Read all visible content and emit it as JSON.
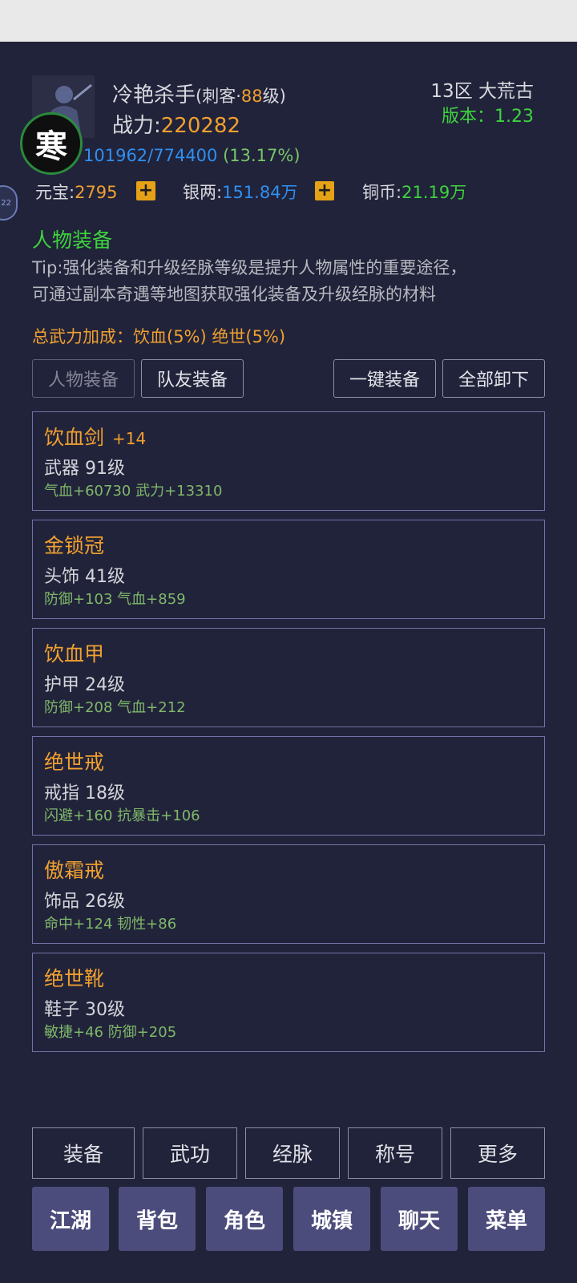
{
  "player": {
    "name": "冷艳杀手",
    "class_prefix": "(刺客·",
    "level": "88",
    "level_suffix": "级)",
    "power_label": "战力:",
    "power_value": "220282",
    "avatar_badge": "寒",
    "side_tab": "22"
  },
  "server": {
    "zone": "13区 大荒古",
    "version_label": "版本：1.23"
  },
  "experience": {
    "value": "101962/774400",
    "percent": "(13.17%)"
  },
  "currency": {
    "yuanbao_label": "元宝:",
    "yuanbao_value": "2795",
    "yinliang_label": "银两:",
    "yinliang_value": "151.84万",
    "tongbi_label": "铜币:",
    "tongbi_value": "21.19万",
    "plus_icon": "+"
  },
  "section": {
    "title": "人物装备",
    "tip_line1": "Tip:强化装备和升级经脉等级是提升人物属性的重要途径，",
    "tip_line2": "可通过副本奇遇等地图获取强化装备及升级经脉的材料",
    "bonus": "总武力加成：饮血(5%) 绝世(5%)"
  },
  "tabs": {
    "self_equipment": "人物装备",
    "teammate_equipment": "队友装备",
    "equip_all": "一键装备",
    "unequip_all": "全部卸下"
  },
  "equipment": [
    {
      "name": "饮血剑",
      "enhance": "+14",
      "type": "武器 91级",
      "stats": "气血+60730 武力+13310"
    },
    {
      "name": "金锁冠",
      "enhance": "",
      "type": "头饰 41级",
      "stats": "防御+103 气血+859"
    },
    {
      "name": "饮血甲",
      "enhance": "",
      "type": "护甲 24级",
      "stats": "防御+208 气血+212"
    },
    {
      "name": "绝世戒",
      "enhance": "",
      "type": "戒指 18级",
      "stats": "闪避+160 抗暴击+106"
    },
    {
      "name": "傲霜戒",
      "enhance": "",
      "type": "饰品 26级",
      "stats": "命中+124 韧性+86"
    },
    {
      "name": "绝世靴",
      "enhance": "",
      "type": "鞋子 30级",
      "stats": "敏捷+46 防御+205"
    }
  ],
  "sub_nav": [
    "装备",
    "武功",
    "经脉",
    "称号",
    "更多"
  ],
  "main_nav": [
    "江湖",
    "背包",
    "角色",
    "城镇",
    "聊天",
    "菜单"
  ],
  "colors": {
    "background": "#21233a",
    "gold": "#f0a030",
    "blue": "#2f8ff0",
    "green": "#3ed33e",
    "stat_green": "#7fb86a",
    "button_fill": "#4c4c7c"
  },
  "icons": {
    "avatar": "character-portrait",
    "badge": "server-seal-badge",
    "plus": "plus-icon"
  }
}
